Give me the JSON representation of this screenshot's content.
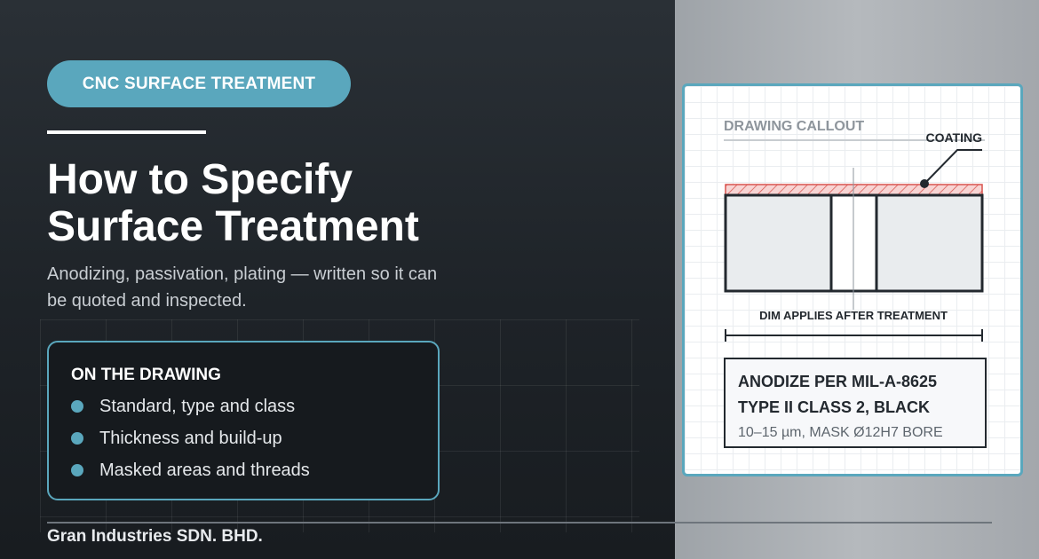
{
  "badge": {
    "label": "CNC SURFACE TREATMENT"
  },
  "hero": {
    "title_line1": "How to Specify",
    "title_line2": "Surface Treatment",
    "subtitle": "Anodizing, passivation, plating — written so it can be quoted and inspected."
  },
  "card": {
    "heading": "ON THE DRAWING",
    "items": [
      {
        "label": "Standard, type and class"
      },
      {
        "label": "Thickness and build-up"
      },
      {
        "label": "Masked areas and threads"
      }
    ]
  },
  "footer": {
    "company": "Gran Industries SDN. BHD."
  },
  "drawing": {
    "header": "DRAWING CALLOUT",
    "coating_label": "COATING",
    "dim_note": "DIM APPLIES AFTER TREATMENT",
    "callout": {
      "line1": "ANODIZE PER MIL-A-8625",
      "line2": "TYPE II CLASS 2, BLACK",
      "note": "10–15 µm, MASK Ø12H7 BORE"
    }
  },
  "colors": {
    "accent": "#5aa7bd",
    "dark_bg": "#1e2328",
    "coating_red": "#d9534f",
    "drawing_ink": "#23292f"
  },
  "icons": {
    "bullet": "circle-bullet-icon",
    "leader": "leader-dot-icon"
  }
}
